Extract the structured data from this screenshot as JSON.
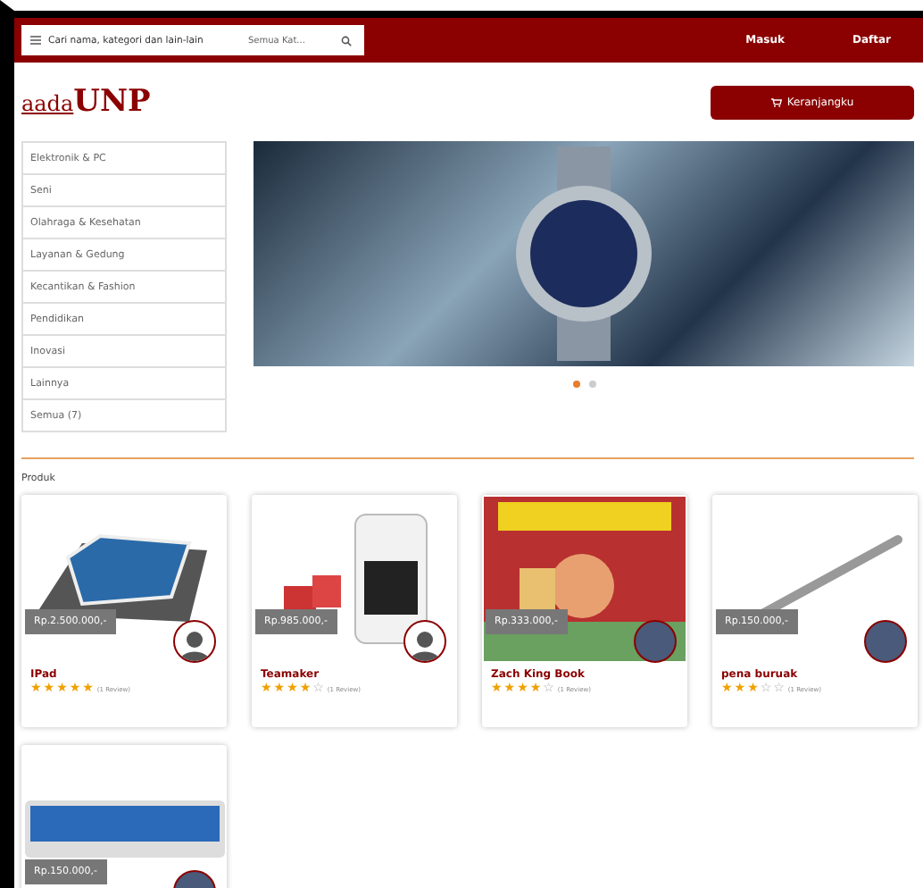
{
  "header": {
    "search_placeholder": "Cari nama, kategori dan lain-lain",
    "category_select": "Semua Kat...",
    "links": [
      "Masuk",
      "Daftar"
    ]
  },
  "logo": {
    "prefix": "aada",
    "suffix": "UNP"
  },
  "cart_button": "Keranjangku",
  "categories": [
    "Elektronik & PC",
    "Seni",
    "Olahraga & Kesehatan",
    "Layanan & Gedung",
    "Kecantikan & Fashion",
    "Pendidikan",
    "Inovasi",
    "Lainnya",
    "Semua (7)"
  ],
  "carousel": {
    "dots": [
      {
        "selected": true
      },
      {
        "selected": false
      }
    ]
  },
  "section_title": "Produk",
  "products": [
    {
      "price": "Rp.2.500.000,-",
      "name": "IPad",
      "stars": 5,
      "reviews": "(1 Review)"
    },
    {
      "price": "Rp.985.000,-",
      "name": "Teamaker",
      "stars": 4,
      "reviews": "(1 Review)"
    },
    {
      "price": "Rp.333.000,-",
      "name": "Zach King Book",
      "stars": 4,
      "reviews": "(1 Review)"
    },
    {
      "price": "Rp.150.000,-",
      "name": "pena buruak",
      "stars": 3,
      "reviews": "(1 Review)"
    },
    {
      "price": "Rp.150.000,-"
    }
  ]
}
